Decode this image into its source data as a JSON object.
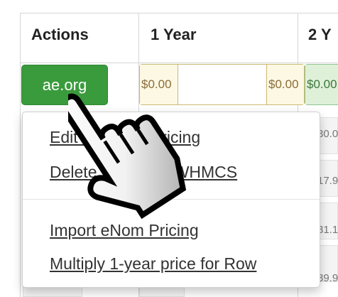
{
  "table": {
    "headers": [
      "Actions",
      "1 Year",
      "2 Y"
    ],
    "row": {
      "domain_button": "ae.org",
      "year1": {
        "prefix": "$0.00",
        "suffix": "$0.00",
        "value": ""
      },
      "year2": {
        "prefix": "$0.00"
      }
    },
    "partial_values": [
      "30.0",
      "17.9",
      "31.1",
      "39.9"
    ]
  },
  "dropdown": {
    "items": [
      {
        "label": "Edit WHMCS Pricing"
      },
      {
        "label": "Delete TLD from WHMCS"
      },
      {
        "label": "Import eNom Pricing"
      },
      {
        "label": "Multiply 1-year price for Row"
      }
    ]
  },
  "colors": {
    "button_green": "#3a9b3c",
    "addon_yellow": "#fcf8e3",
    "addon_green": "#dff0d8"
  },
  "icons": [
    "hand-pointer-cursor-icon"
  ]
}
